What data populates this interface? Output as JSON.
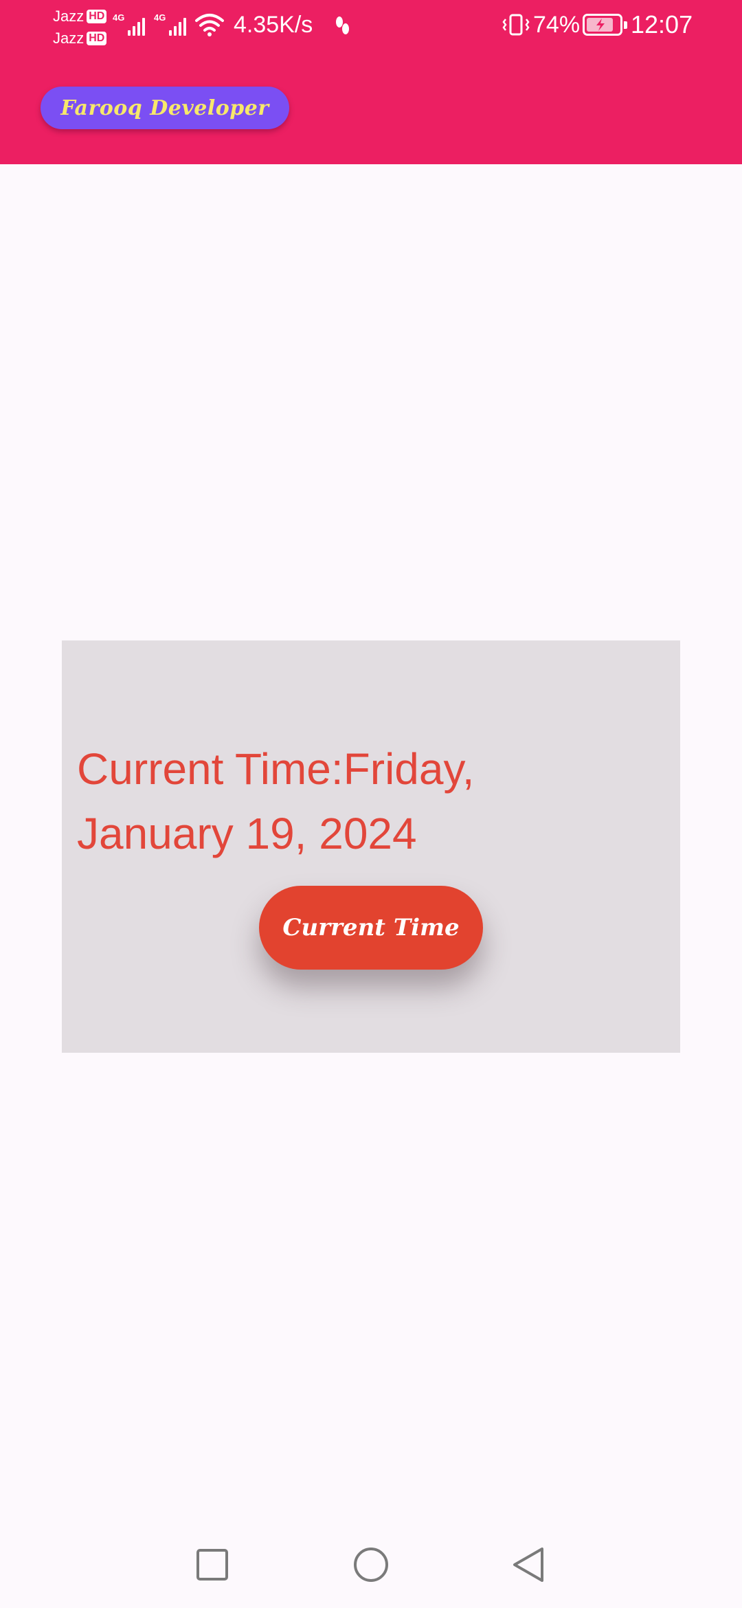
{
  "status_bar": {
    "carrier_1": "Jazz",
    "carrier_2": "Jazz",
    "hd_badge": "HD",
    "network_1": "4G",
    "network_2": "4G",
    "speed": "4.35K/s",
    "battery_percent": "74%",
    "battery_level": 0.74,
    "time": "12:07",
    "icons": [
      "signal-icon",
      "wifi-icon",
      "step-counter-icon",
      "vibrate-icon",
      "battery-charging-icon"
    ]
  },
  "app_bar": {
    "background_color": "#ec1f62",
    "brand_label": "Farooq Developer",
    "brand_pill_color": "#7b4ff3",
    "brand_text_color": "#f7e86a"
  },
  "card": {
    "background_color": "#e2dde1",
    "current_time_text": "Current Time:Friday, January 19, 2024",
    "text_color": "#e2463a",
    "button_label": "Current Time",
    "button_color": "#e2432f"
  },
  "nav_bar": {
    "items": [
      "recent-apps-icon",
      "home-icon",
      "back-icon"
    ]
  }
}
